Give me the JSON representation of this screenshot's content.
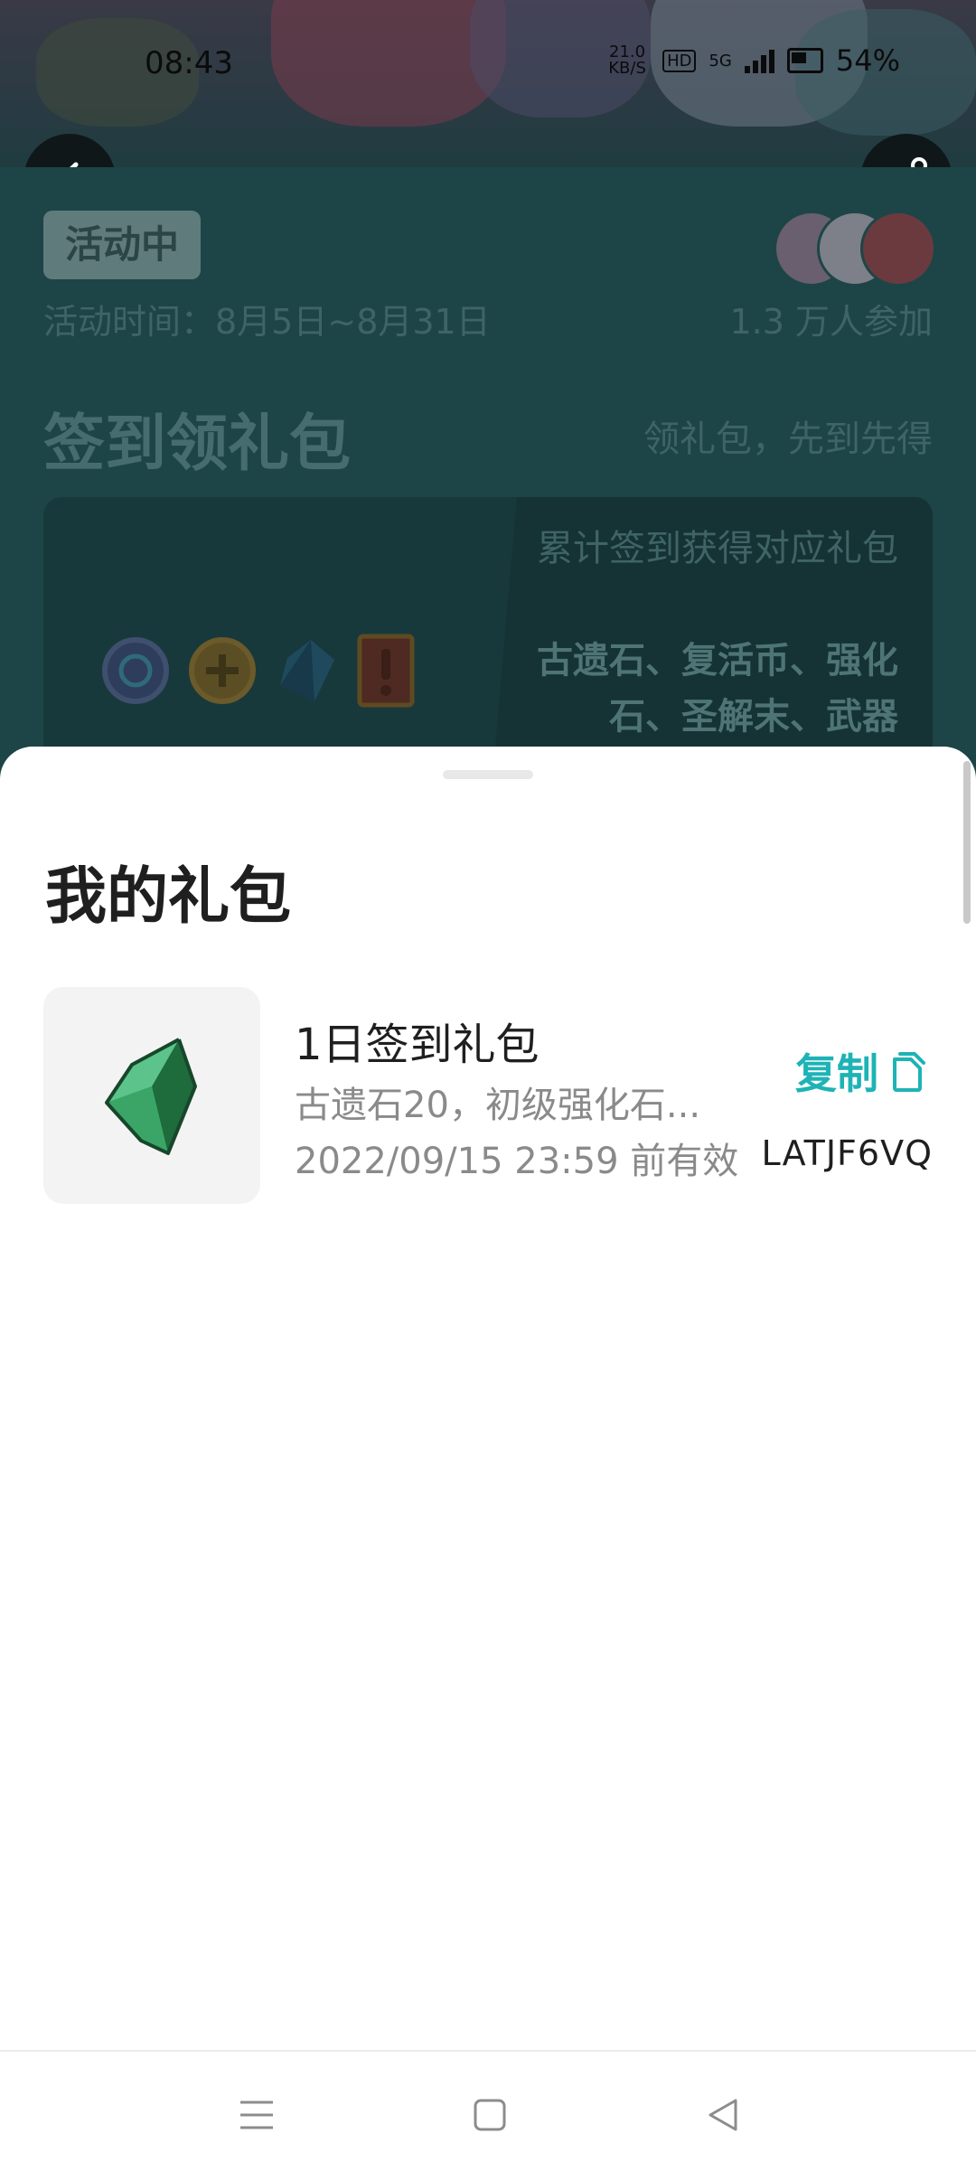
{
  "status_bar": {
    "time": "08:43",
    "net_speed_value": "21.0",
    "net_speed_unit": "KB/S",
    "hd": "HD",
    "network": "5G",
    "battery": "54%"
  },
  "header": {
    "back_icon": "chevron-left-icon",
    "share_icon": "share-icon"
  },
  "activity": {
    "status_tag": "活动中",
    "time_range": "活动时间：8月5日~8月31日",
    "participants": "1.3 万人参加",
    "section_title": "签到领礼包",
    "section_subtitle": "领礼包，先到先得",
    "card_desc": "累计签到获得对应礼包",
    "card_items": "古遗石、复活币、强化石、圣解末、武器"
  },
  "sheet": {
    "title": "我的礼包",
    "gifts": [
      {
        "name": "1日签到礼包",
        "items": "古遗石20，初级强化石...",
        "expire": "2022/09/15 23:59 前有效",
        "copy_label": "复制",
        "code": "LATJF6VQ"
      }
    ]
  },
  "colors": {
    "accent": "#1eb3b6",
    "dim_background": "#1d4548",
    "text_primary": "#1f1f1f",
    "text_secondary": "#8a8a8a"
  },
  "navbar": {
    "menu_icon": "menu-icon",
    "home_icon": "home-square-icon",
    "back_icon": "back-triangle-icon"
  }
}
